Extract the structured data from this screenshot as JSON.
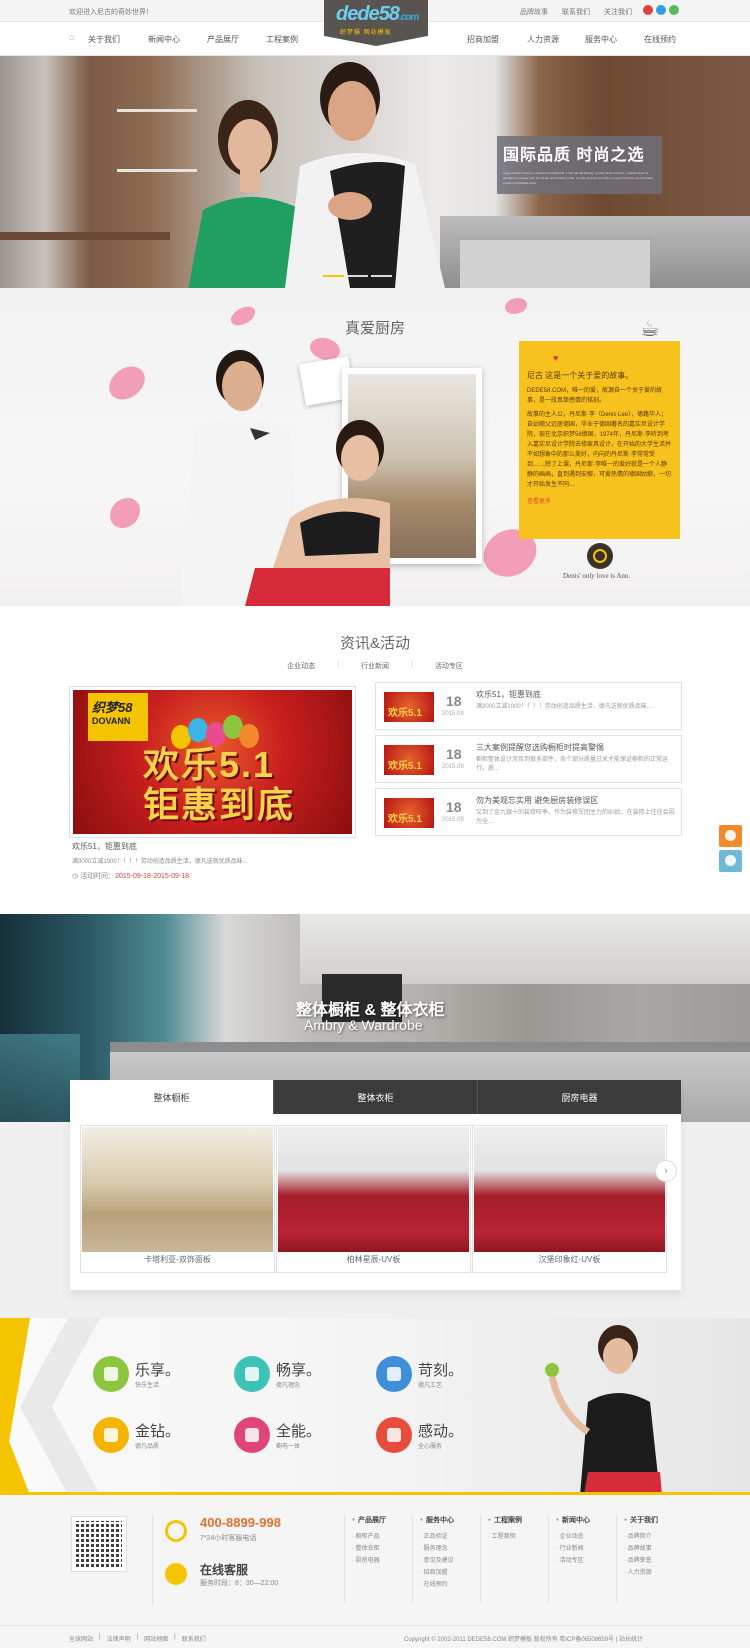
{
  "topbar": {
    "welcome": "欢迎进入尼古的奇妙世界！",
    "links": [
      "品牌故事",
      "联系我们",
      "关注我们"
    ],
    "social_colors": [
      "#e04040",
      "#2fa0df",
      "#5cb85c"
    ]
  },
  "logo": {
    "main": "dede",
    "num": "58",
    "dotcom": ".com",
    "sub": "织梦猫 网站模板"
  },
  "nav": {
    "left": [
      "关于我们",
      "新闻中心",
      "产品展厅",
      "工程案例"
    ],
    "right": [
      "招商加盟",
      "人力资源",
      "服务中心",
      "在线预约"
    ]
  },
  "hero": {
    "title": "国际品质  时尚之选",
    "desc": "Vogue kitchen interior, a casual and stylish life, it has natural flowing, to bring taste to home, a classic style for attitudes to escape from the bustle and troubles of life, a mode to show your life in a good mood by one thousand, it feels comfortable since.",
    "slides": 3,
    "active_slide": 0
  },
  "story": {
    "title": "真爱厨房",
    "heading": "尼古 这是一个关于爱的故事。",
    "line1": "DEDE58.COM，唯一的爱，故源自一个关于爱的故事，是一段真挚感情的铭刻。",
    "body": "故事的主人公，丹尼斯·李（Denis Lee），德籍华人；自幼随父迈居德国，毕业于德国著名的嘉实尼设计学院，现在北京织梦58德国，1974年，丹尼斯·李听到考入嘉实尼设计学院去修家具设计，在开始的大学生活并不如想象中的那么美好，内向的丹尼斯·李常常受到……除了上课，丹尼斯·李唯一的爱好就是一个人静静的画画，直到遇到安娜，可爱热情的德国姑娘，一切才开始发生不同…",
    "more": "查看更多",
    "signature": "Denis' only love is Ann."
  },
  "news": {
    "title": "资讯&活动",
    "tabs": [
      "企业动态",
      "行业新闻",
      "活动专区"
    ],
    "featured": {
      "logo_top": "织梦58",
      "logo_bottom": "DOVANN",
      "banner_line1": "欢乐5.1",
      "banner_line2": "钜惠到底",
      "title": "欢乐51，钜惠到底",
      "desc": "满3000立减1000！！！！劳动创造品质生活，德凡送就优质品味...",
      "time_label": "活动时间：",
      "time_value": "2015-09-18-2015-09-18"
    },
    "items": [
      {
        "day": "18",
        "ym": "2015.09",
        "title": "欢乐51，钜惠到底",
        "desc": "满3000立减1000！！！！劳动创造品质生活，德凡送就优质品味...",
        "thumb": "欢乐5.1"
      },
      {
        "day": "18",
        "ym": "2015.09",
        "title": "三大案例提醒您选购橱柜时提高警惕",
        "desc": "橱柜整体设计涉及到很多部件，各个部分质量过关才能保证橱柜的正常运行。质...",
        "thumb": "欢乐5.1"
      },
      {
        "day": "18",
        "ym": "2015.09",
        "title": "勿为美观忘实用 避免厨房装修误区",
        "desc": "又到了金九银十的装修旺季，作为装修军团主力的80后，在装修上往往会因为全...",
        "thumb": "欢乐5.1"
      }
    ]
  },
  "products": {
    "title_cn": "整体橱柜 & 整体衣柜",
    "title_en": "Ambry & Wardrobe",
    "tabs": [
      "整体橱柜",
      "整体衣柜",
      "厨房电器"
    ],
    "active_tab": 0,
    "items": [
      {
        "caption": "卡塔利亚-双饰面板"
      },
      {
        "caption": "柏林星辰-UV板"
      },
      {
        "caption": "汉堡印象红-UV板"
      }
    ],
    "next": "›"
  },
  "features": [
    {
      "title": "乐享。",
      "sub": "快乐生活",
      "color": "#8cc63f"
    },
    {
      "title": "畅享。",
      "sub": "德凡理念",
      "color": "#3cc3b6"
    },
    {
      "title": "苛刻。",
      "sub": "德凡工艺",
      "color": "#3f8fd8"
    },
    {
      "title": "金钻。",
      "sub": "德凡品质",
      "color": "#f5b400"
    },
    {
      "title": "全能。",
      "sub": "橱电一体",
      "color": "#e0457a"
    },
    {
      "title": "感动。",
      "sub": "全心服务",
      "color": "#e84c3d"
    }
  ],
  "footer": {
    "phone": "400-8899-998",
    "phone_sub": "7*24小时客服电话",
    "cs_title": "在线客服",
    "cs_sub": "服务时段：8：30—22:00",
    "columns": [
      {
        "title": "产品展厅",
        "items": [
          "橱柜产品",
          "整体衣柜",
          "厨房电器"
        ]
      },
      {
        "title": "服务中心",
        "items": [
          "正品验证",
          "服务理念",
          "意见及建议",
          "招商加盟",
          "在线预约"
        ]
      },
      {
        "title": "工程案例",
        "items": [
          "工程案例"
        ]
      },
      {
        "title": "新闻中心",
        "items": [
          "企业动态",
          "行业新闻",
          "活动专区"
        ]
      },
      {
        "title": "关于我们",
        "items": [
          "品牌简介",
          "品牌故事",
          "品牌荣誉",
          "人力资源"
        ]
      }
    ]
  },
  "copyright": {
    "links": [
      "全球网站",
      "|",
      "法律声明",
      "|",
      "网站地图",
      "|",
      "联系我们"
    ],
    "text": "Copyright © 2002-2011 DEDE58.COM 织梦模板 版权所有 粤ICP备06508659号 | 站长统计"
  }
}
